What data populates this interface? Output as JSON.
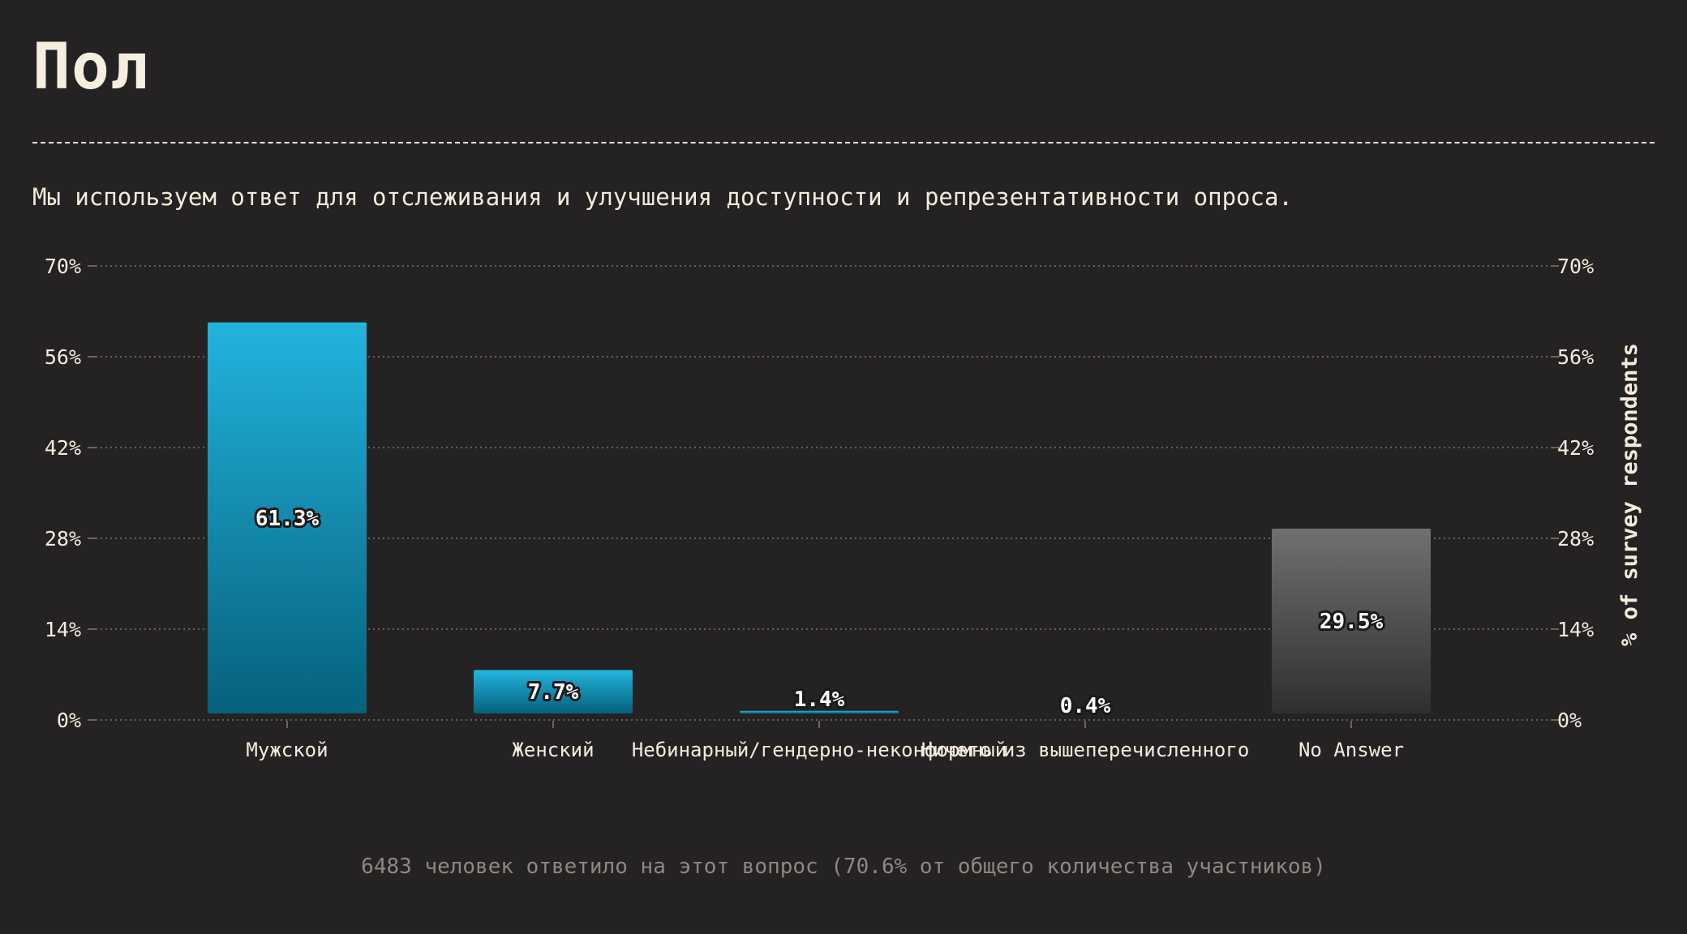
{
  "page": {
    "title": "Пол",
    "subtitle": "Мы используем ответ для отслеживания и улучшения доступности и репрезентативности опроса.",
    "footnote": "6483 человек ответило на этот вопрос (70.6% от общего количества участников)"
  },
  "colors": {
    "background": "#252223",
    "primary_top": "#22b4dd",
    "primary_bottom": "#06607c",
    "neutral_top": "#707070",
    "neutral_bottom": "#2f2f30",
    "text": "#f3ecdd",
    "grid": "#7a766f"
  },
  "chart_data": {
    "type": "bar",
    "categories": [
      "Мужской",
      "Женский",
      "Небинарный/гендерно-неконформный",
      "Ничего из вышеперечисленного",
      "No Answer"
    ],
    "values": [
      61.3,
      7.7,
      1.4,
      0.4,
      29.5
    ],
    "value_labels": [
      "61.3%",
      "7.7%",
      "1.4%",
      "0.4%",
      "29.5%"
    ],
    "bar_styles": [
      "primary",
      "primary",
      "primary",
      "primary",
      "neutral"
    ],
    "ylabel": "% of survey respondents",
    "ylim": [
      0,
      70
    ],
    "yticks": [
      0,
      14,
      28,
      42,
      56,
      70
    ],
    "ytick_labels": [
      "0%",
      "14%",
      "28%",
      "42%",
      "56%",
      "70%"
    ],
    "grid": true
  }
}
